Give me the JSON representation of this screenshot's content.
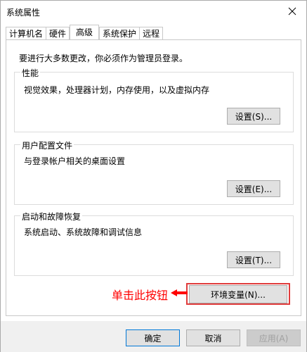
{
  "window": {
    "title": "系统属性"
  },
  "tabs": [
    {
      "label": "计算机名"
    },
    {
      "label": "硬件"
    },
    {
      "label": "高级"
    },
    {
      "label": "系统保护"
    },
    {
      "label": "远程"
    }
  ],
  "active_tab": "高级",
  "advanced": {
    "admin_note": "要进行大多数更改，你必须作为管理员登录。",
    "performance": {
      "title": "性能",
      "description": "视觉效果，处理器计划，内存使用，以及虚拟内存",
      "button": "设置(S)..."
    },
    "user_profiles": {
      "title": "用户配置文件",
      "description": "与登录帐户相关的桌面设置",
      "button": "设置(E)..."
    },
    "startup_recovery": {
      "title": "启动和故障恢复",
      "description": "系统启动、系统故障和调试信息",
      "button": "设置(T)..."
    },
    "env_button": "环境变量(N)..."
  },
  "annotation": {
    "text": "单击此按钮",
    "color": "#ff0000"
  },
  "footer": {
    "ok": "确定",
    "cancel": "取消",
    "apply": "应用(A)"
  },
  "icons": {
    "close": "close-icon",
    "arrow": "arrow-left-icon"
  }
}
